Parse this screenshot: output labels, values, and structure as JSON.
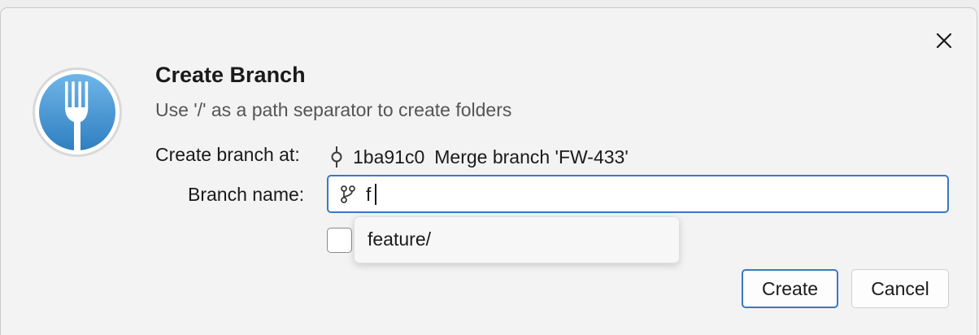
{
  "dialog": {
    "title": "Create Branch",
    "subtitle": "Use '/' as a path separator to create folders",
    "close_icon": "close-icon",
    "logo_icon": "fork-icon"
  },
  "form": {
    "branch_at_label": "Create branch at:",
    "commit_icon": "commit-icon",
    "commit_hash": "1ba91c0",
    "commit_message": "Merge branch 'FW-433'",
    "branch_name_label": "Branch name:",
    "branch_icon": "branch-icon",
    "branch_name_value": "f",
    "checkbox_checked": false
  },
  "autocomplete": {
    "items": [
      {
        "label": "feature/"
      }
    ]
  },
  "buttons": {
    "create_label": "Create",
    "cancel_label": "Cancel"
  },
  "colors": {
    "accent": "#3a78c0",
    "logo_gradient_top": "#6fb5e8",
    "logo_gradient_bottom": "#2f7fc1"
  }
}
